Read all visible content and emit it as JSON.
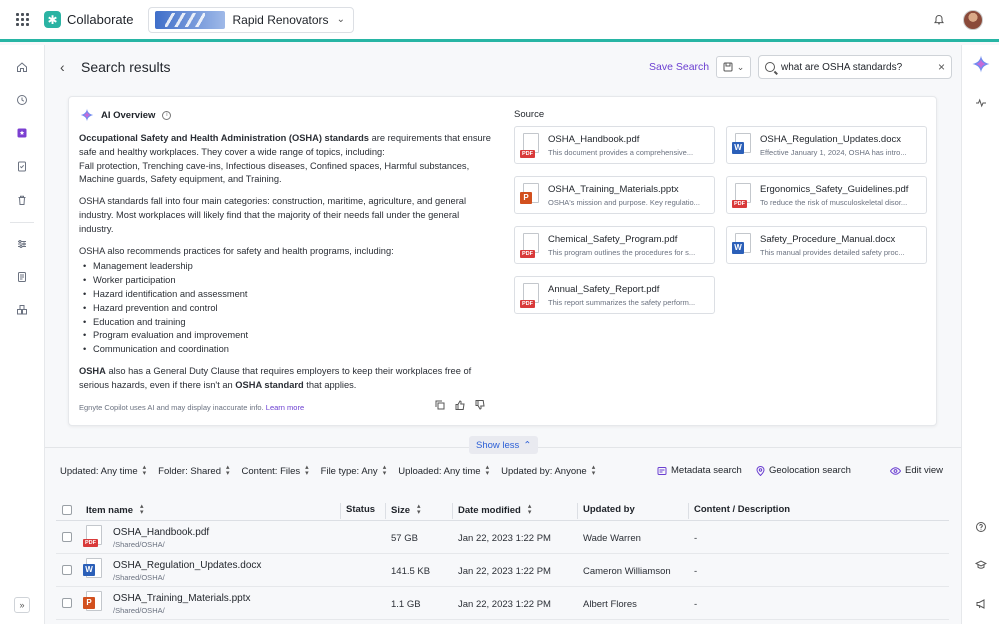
{
  "app": {
    "name": "Collaborate",
    "workspace": "Rapid Renovators"
  },
  "header": {
    "title": "Search results",
    "save_search": "Save Search"
  },
  "search": {
    "value": "what are OSHA standards?",
    "placeholder": ""
  },
  "ai_overview": {
    "title": "AI Overview",
    "p1_bold": "Occupational Safety and Health Administration (OSHA) standards",
    "p1_rest": " are requirements that ensure safe and healthy workplaces. They cover a wide range of topics, including:",
    "p1_topics": "Fall protection, Trenching cave-ins, Infectious diseases, Confined spaces, Harmful substances, Machine guards, Safety equipment, and Training.",
    "p2": "OSHA standards fall into four main categories: construction, maritime, agriculture, and general industry. Most workplaces will likely find that the majority of their needs fall under the general industry.",
    "p3": "OSHA also recommends practices for safety and health programs, including:",
    "bullets": [
      "Management leadership",
      "Worker participation",
      "Hazard identification and assessment",
      "Hazard prevention and control",
      "Education and training",
      "Program evaluation and improvement",
      "Communication and coordination"
    ],
    "p4_a": "OSHA",
    "p4_b": " also has a General Duty Clause that requires employers to keep their workplaces free of serious hazards, even if there isn't an ",
    "p4_c": "OSHA standard",
    "p4_d": " that applies.",
    "disclaimer": "Egnyte Copilot uses AI and may display inaccurate info.",
    "learn_more": "Learn more",
    "source_label": "Source",
    "sources": [
      {
        "name": "OSHA_Handbook.pdf",
        "desc": "This document provides a comprehensive...",
        "type": "pdf"
      },
      {
        "name": "OSHA_Regulation_Updates.docx",
        "desc": "Effective January 1, 2024, OSHA has intro...",
        "type": "docx"
      },
      {
        "name": "OSHA_Training_Materials.pptx",
        "desc": "OSHA's mission and purpose. Key regulatio...",
        "type": "pptx"
      },
      {
        "name": "Ergonomics_Safety_Guidelines.pdf",
        "desc": "To reduce the risk of musculoskeletal disor...",
        "type": "pdf"
      },
      {
        "name": "Chemical_Safety_Program.pdf",
        "desc": "This program outlines the procedures for s...",
        "type": "pdf"
      },
      {
        "name": "Safety_Procedure_Manual.docx",
        "desc": "This manual provides detailed safety proc...",
        "type": "docx"
      },
      {
        "name": "Annual_Safety_Report.pdf",
        "desc": "This report summarizes the safety perform...",
        "type": "pdf"
      }
    ],
    "show_less": "Show less"
  },
  "filters": {
    "updated": "Updated: Any time",
    "folder": "Folder: Shared",
    "content": "Content: Files",
    "file_type": "File type: Any",
    "uploaded": "Uploaded: Any time",
    "updated_by": "Updated by: Anyone",
    "metadata_search": "Metadata search",
    "geolocation_search": "Geolocation search",
    "edit_view": "Edit view"
  },
  "table": {
    "columns": [
      "Item name",
      "Status",
      "Size",
      "Date modified",
      "Updated by",
      "Content / Description"
    ],
    "rows": [
      {
        "name": "OSHA_Handbook.pdf",
        "path": "/Shared/OSHA/",
        "status": "",
        "size": "57 GB",
        "date": "Jan 22, 2023 1:22 PM",
        "updated_by": "Wade Warren",
        "desc": "-",
        "type": "pdf"
      },
      {
        "name": "OSHA_Regulation_Updates.docx",
        "path": "/Shared/OSHA/",
        "status": "",
        "size": "141.5 KB",
        "date": "Jan 22, 2023 1:22 PM",
        "updated_by": "Cameron Williamson",
        "desc": "-",
        "type": "docx"
      },
      {
        "name": "OSHA_Training_Materials.pptx",
        "path": "/Shared/OSHA/",
        "status": "",
        "size": "1.1 GB",
        "date": "Jan 22, 2023 1:22 PM",
        "updated_by": "Albert Flores",
        "desc": "-",
        "type": "pptx"
      }
    ]
  },
  "colors": {
    "accent": "#6b3fd1",
    "topbar_line": "#27b5a4",
    "pdf": "#d93a3a",
    "docx": "#2b5fb8",
    "pptx": "#d2501e"
  }
}
